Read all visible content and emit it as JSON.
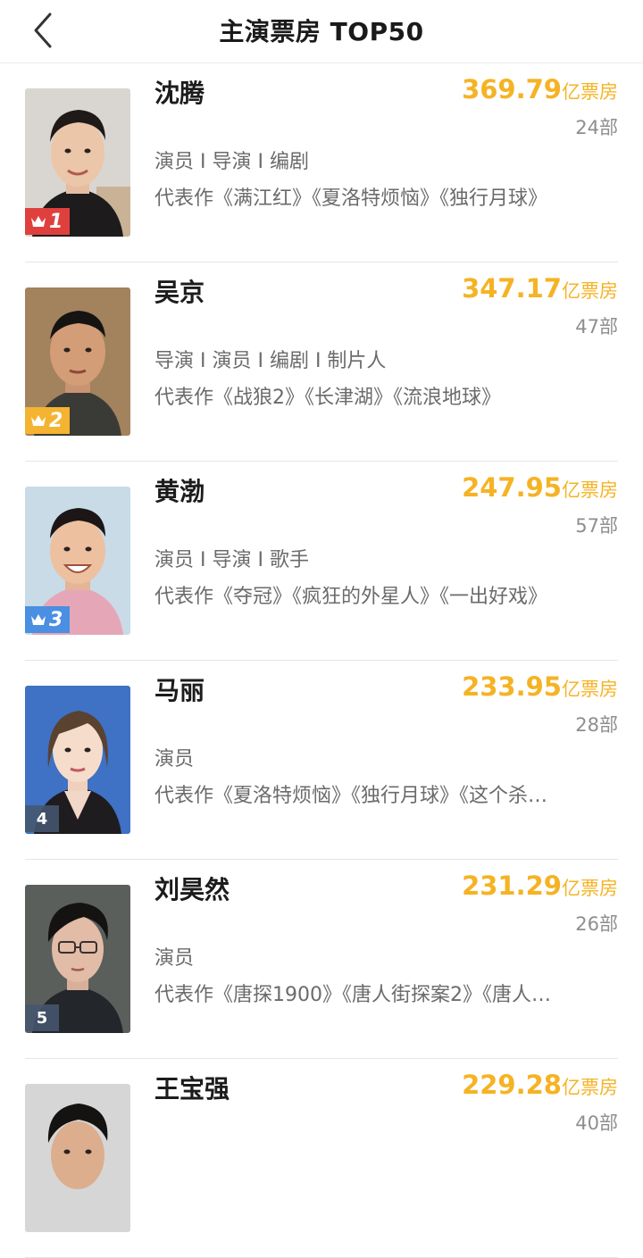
{
  "header": {
    "title": "主演票房 TOP50"
  },
  "colors": {
    "box_office": "#f5b324",
    "rank1": "#e0403d",
    "rank2": "#f4b432",
    "rank3": "#4a8fe2",
    "rank_plain": "#46566e"
  },
  "list": [
    {
      "rank": "1",
      "name": "沈腾",
      "box_value": "369.79",
      "box_unit": "亿票房",
      "count": "24部",
      "roles": "演员 I 导演 I 编剧",
      "works": "代表作《满江红》《夏洛特烦恼》《独行月球》",
      "badge_icon": "crown-icon"
    },
    {
      "rank": "2",
      "name": "吴京",
      "box_value": "347.17",
      "box_unit": "亿票房",
      "count": "47部",
      "roles": "导演 I 演员 I 编剧 I 制片人",
      "works": "代表作《战狼2》《长津湖》《流浪地球》",
      "badge_icon": "crown-icon"
    },
    {
      "rank": "3",
      "name": "黄渤",
      "box_value": "247.95",
      "box_unit": "亿票房",
      "count": "57部",
      "roles": "演员 I 导演 I 歌手",
      "works": "代表作《夺冠》《疯狂的外星人》《一出好戏》",
      "badge_icon": "crown-icon"
    },
    {
      "rank": "4",
      "name": "马丽",
      "box_value": "233.95",
      "box_unit": "亿票房",
      "count": "28部",
      "roles": "演员",
      "works": "代表作《夏洛特烦恼》《独行月球》《这个杀…"
    },
    {
      "rank": "5",
      "name": "刘昊然",
      "box_value": "231.29",
      "box_unit": "亿票房",
      "count": "26部",
      "roles": "演员",
      "works": "代表作《唐探1900》《唐人街探案2》《唐人…"
    },
    {
      "rank": "",
      "name": "王宝强",
      "box_value": "229.28",
      "box_unit": "亿票房",
      "count": "40部",
      "roles": "",
      "works": ""
    }
  ]
}
